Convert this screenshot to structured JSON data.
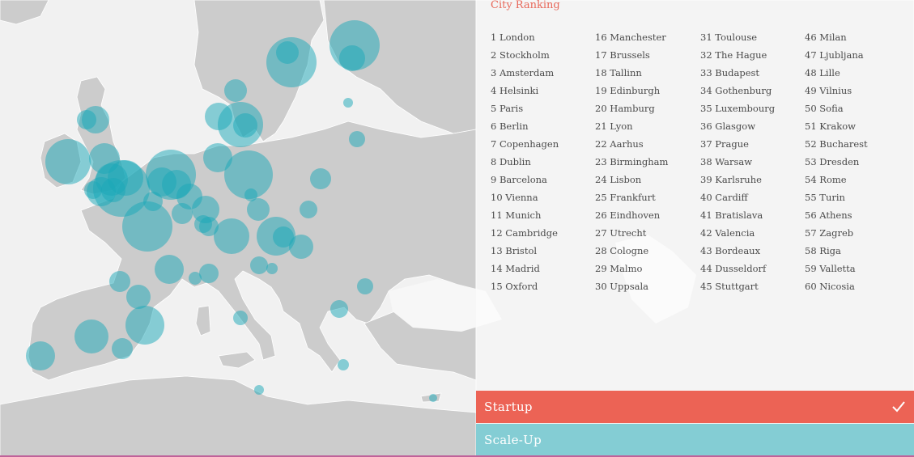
{
  "colors": {
    "land": "#cccccc",
    "sea": "#f1f1f1",
    "border": "#ffffff",
    "bubble": "#1aa7b8",
    "accent_red": "#ec6355",
    "accent_teal": "#84cdd4"
  },
  "ranking": {
    "title": "City Ranking",
    "columns": [
      [
        "1 London",
        "2 Stockholm",
        "3 Amsterdam",
        "4 Helsinki",
        "5 Paris",
        "6 Berlin",
        "7 Copenhagen",
        "8 Dublin",
        "9 Barcelona",
        "10 Vienna",
        "11 Munich",
        "12 Cambridge",
        "13 Bristol",
        "14 Madrid",
        "15 Oxford"
      ],
      [
        "16 Manchester",
        "17 Brussels",
        "18 Tallinn",
        "19 Edinburgh",
        "20 Hamburg",
        "21 Lyon",
        "22 Aarhus",
        "23 Birmingham",
        "24 Lisbon",
        "25 Frankfurt",
        "26 Eindhoven",
        "27 Utrecht",
        "28 Cologne",
        "29 Malmo",
        "30 Uppsala"
      ],
      [
        "31 Toulouse",
        "32 The Hague",
        "33 Budapest",
        "34 Gothenburg",
        "35 Luxembourg",
        "36 Glasgow",
        "37 Prague",
        "38 Warsaw",
        "39 Karlsruhe",
        "40 Cardiff",
        "41 Bratislava",
        "42 Valencia",
        "43 Bordeaux",
        "44 Dusseldorf",
        "45 Stuttgart"
      ],
      [
        "46 Milan",
        "47 Ljubljana",
        "48 Lille",
        "49 Vilnius",
        "50 Sofia",
        "51 Krakow",
        "52 Bucharest",
        "53 Dresden",
        "54 Rome",
        "55 Turin",
        "56 Athens",
        "57 Zagreb",
        "58 Riga",
        "59 Valletta",
        "60 Nicosia"
      ]
    ]
  },
  "tabs": {
    "startup": {
      "label": "Startup",
      "selected": true
    },
    "scaleup": {
      "label": "Scale-Up",
      "selected": false
    }
  }
}
